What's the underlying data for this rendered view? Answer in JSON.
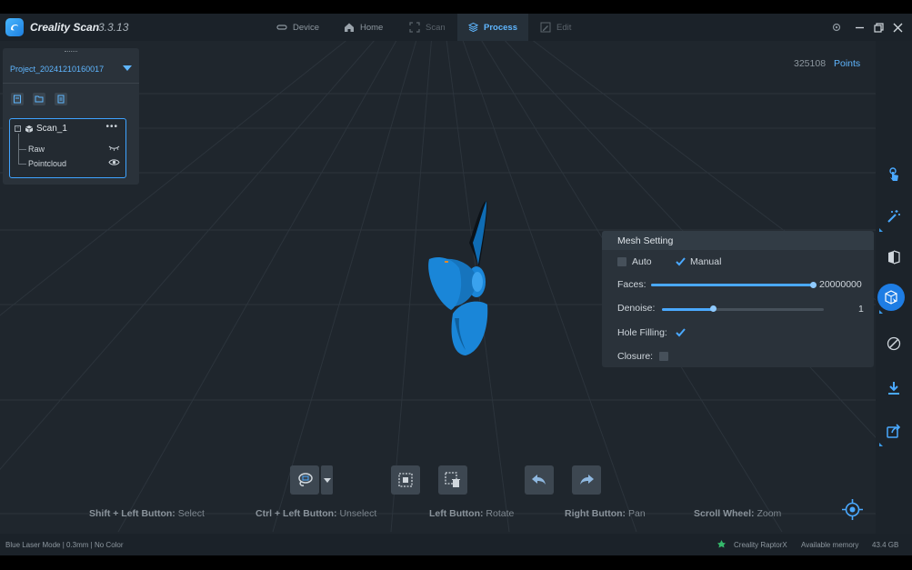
{
  "app": {
    "name": "Creality Scan",
    "version": "3.3.13"
  },
  "nav": {
    "tabs": [
      {
        "label": "Device",
        "icon": "link-icon",
        "state": "normal"
      },
      {
        "label": "Home",
        "icon": "home-icon",
        "state": "normal"
      },
      {
        "label": "Scan",
        "icon": "scan-icon",
        "state": "disabled"
      },
      {
        "label": "Process",
        "icon": "layers-icon",
        "state": "active"
      },
      {
        "label": "Edit",
        "icon": "edit-icon",
        "state": "disabled"
      }
    ]
  },
  "project": {
    "name": "Project_20241210160017",
    "scan": {
      "name": "Scan_1",
      "menu": "•••",
      "expander": "−",
      "children": [
        {
          "label": "Raw",
          "visibility_icon": "eye-closed-icon"
        },
        {
          "label": "Pointcloud",
          "visibility_icon": "eye-open-icon"
        }
      ]
    }
  },
  "viewport": {
    "point_count": "325108",
    "point_label": "Points"
  },
  "mesh_setting": {
    "title": "Mesh Setting",
    "auto_label": "Auto",
    "auto_checked": false,
    "manual_label": "Manual",
    "manual_checked": true,
    "faces_label": "Faces:",
    "faces_value": "20000000",
    "faces_fraction": 1.0,
    "denoise_label": "Denoise:",
    "denoise_value": "1",
    "denoise_fraction": 0.32,
    "hole_filling_label": "Hole Filling:",
    "hole_filling_checked": true,
    "closure_label": "Closure:",
    "closure_checked": false
  },
  "hints": [
    {
      "key": "Shift + Left Button:",
      "action": "Select"
    },
    {
      "key": "Ctrl + Left Button:",
      "action": "Unselect"
    },
    {
      "key": "Left Button:",
      "action": "Rotate"
    },
    {
      "key": "Right Button:",
      "action": "Pan"
    },
    {
      "key": "Scroll Wheel:",
      "action": "Zoom"
    }
  ],
  "status": {
    "mode": "Blue Laser Mode | 0.3mm | No Color",
    "device": "Creality RaptorX",
    "memory_label": "Available memory",
    "memory_value": "43.4 GB"
  },
  "colors": {
    "accent": "#3fa3ff",
    "model": "#1a86d8",
    "background": "#1f262d",
    "status_green": "#35b86b"
  }
}
